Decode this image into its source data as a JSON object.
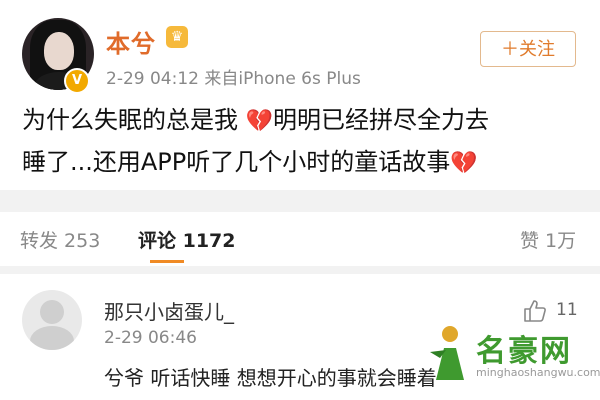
{
  "post": {
    "username": "本兮",
    "timestamp": "2-29 04:12",
    "source": "来自iPhone 6s Plus",
    "follow_label": "＋关注",
    "text_line1_a": "为什么失眠的总是我",
    "text_line1_b": "明明已经拼尽全力去",
    "text_line2": "睡了...还用APP听了几个小时的童话故事",
    "icons": [
      "verified-badge-icon",
      "vip-crown-icon",
      "broken-heart-icon"
    ]
  },
  "tabs": {
    "repost_label": "转发 253",
    "comment_label": "评论 1172",
    "like_label": "赞 1万"
  },
  "comment": {
    "name": "那只小卤蛋儿_",
    "time": "2-29 06:46",
    "like_count": "11",
    "text": "兮爷 听话快睡 想想开心的事就会睡着"
  },
  "watermark": {
    "brand": "名豪网",
    "url": "minghaoshangwu.com"
  },
  "colors": {
    "username": "#e06b2a",
    "accent": "#f08a24",
    "heart": "#d4352d",
    "watermark": "#3f9a2f"
  }
}
